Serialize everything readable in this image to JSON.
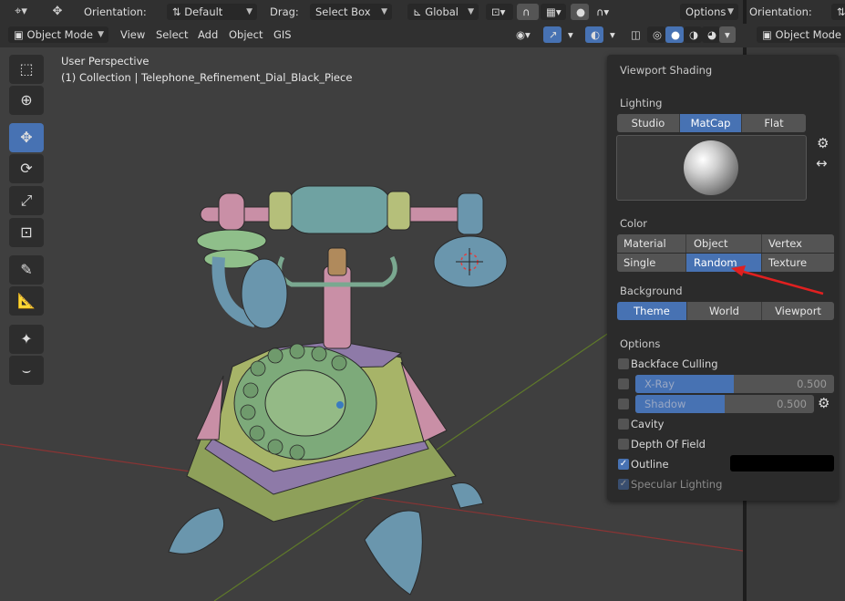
{
  "header": {
    "orientation_label": "Orientation:",
    "orientation_value": "Default",
    "drag_label": "Drag:",
    "drag_value": "Select Box",
    "transform_space": "Global",
    "options_label": "Options",
    "right_orientation_label": "Orientation:"
  },
  "header2": {
    "mode": "Object Mode",
    "menus": [
      "View",
      "Select",
      "Add",
      "Object",
      "GIS"
    ],
    "right_mode": "Object Mode"
  },
  "viewport": {
    "perspective": "User Perspective",
    "collection": "(1) Collection | Telephone_Refinement_Dial_Black_Piece"
  },
  "panel": {
    "title": "Viewport Shading",
    "lighting_label": "Lighting",
    "lighting": [
      "Studio",
      "MatCap",
      "Flat"
    ],
    "lighting_selected": "MatCap",
    "color_label": "Color",
    "color_row1": [
      "Material",
      "Object",
      "Vertex"
    ],
    "color_row2": [
      "Single",
      "Random",
      "Texture"
    ],
    "color_selected": "Random",
    "background_label": "Background",
    "background": [
      "Theme",
      "World",
      "Viewport"
    ],
    "background_selected": "Theme",
    "options_label": "Options",
    "backface_culling": "Backface Culling",
    "xray_label": "X-Ray",
    "xray_value": "0.500",
    "shadow_label": "Shadow",
    "shadow_value": "0.500",
    "cavity": "Cavity",
    "depth_of_field": "Depth Of Field",
    "outline": "Outline",
    "specular": "Specular Lighting"
  },
  "colors": {
    "accent": "#4772b3",
    "arrow": "#e02020"
  }
}
